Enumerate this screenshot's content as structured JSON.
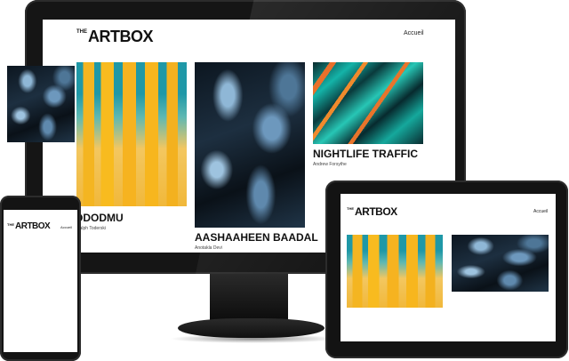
{
  "brand": {
    "the": "THE",
    "name": "ARTBOX"
  },
  "nav": {
    "home_label": "Accueil"
  },
  "artworks": [
    {
      "title": "ODODMU",
      "artist": "Ralph Toderski"
    },
    {
      "title": "AASHAAHEEN BAADAL",
      "artist": "Anotakla Devi"
    },
    {
      "title": "NIGHTLIFE TRAFFIC",
      "artist": "Andrew Forsythe"
    }
  ],
  "colors": {
    "device_frame": "#151515",
    "screen_bg": "#ffffff",
    "text": "#111111"
  }
}
